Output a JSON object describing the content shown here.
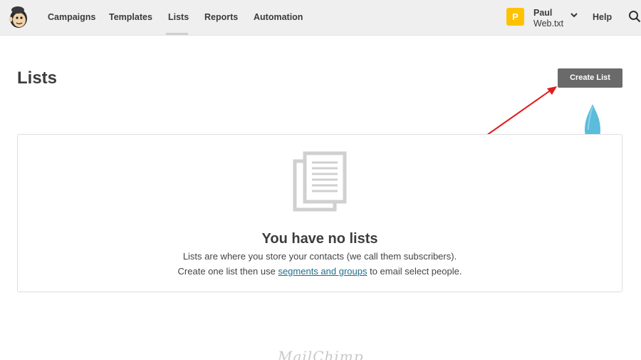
{
  "nav": {
    "items": [
      {
        "label": "Campaigns"
      },
      {
        "label": "Templates"
      },
      {
        "label": "Lists"
      },
      {
        "label": "Reports"
      },
      {
        "label": "Automation"
      }
    ],
    "active": "Lists"
  },
  "account": {
    "avatar_letter": "P",
    "name": "Paul",
    "company": "Web.txt",
    "help_label": "Help"
  },
  "page": {
    "title": "Lists",
    "create_button_label": "Create List"
  },
  "empty_state": {
    "title": "You have no lists",
    "line1": "Lists are where you store your contacts (we call them subscribers).",
    "line2_before": "Create one list then use ",
    "line2_link": "segments and groups",
    "line2_after": " to email select people."
  },
  "footer": {
    "logo_text": "MailChimp"
  },
  "colors": {
    "topbar_bg": "#efefef",
    "avatar": "#ffc200",
    "button": "#6a6a6a",
    "link": "#1d6f8a",
    "arrow": "#e31b1b",
    "drop": "#5bbcdc"
  },
  "icons": {
    "logo": "mailchimp-freddie-icon",
    "chevron": "chevron-down-icon",
    "search": "search-icon",
    "empty": "document-stack-icon"
  }
}
